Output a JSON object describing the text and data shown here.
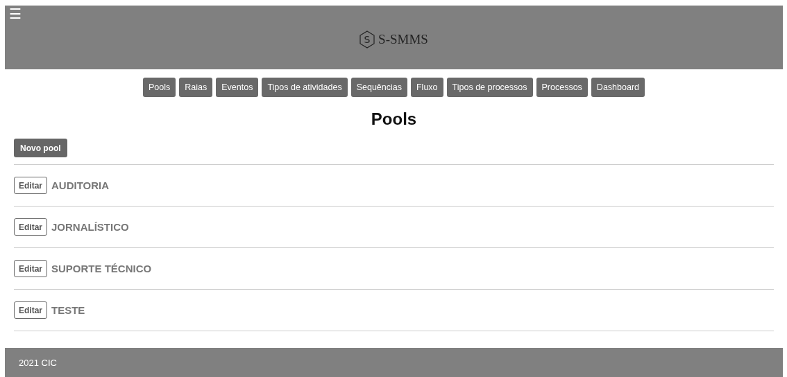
{
  "header": {
    "menu_glyph": "☰",
    "brand": "S-SMMS",
    "logo_letter": "S"
  },
  "nav": [
    "Pools",
    "Raias",
    "Eventos",
    "Tipos de atividades",
    "Sequências",
    "Fluxo",
    "Tipos de processos",
    "Processos",
    "Dashboard"
  ],
  "page_title": "Pools",
  "new_button": "Novo pool",
  "pools": [
    {
      "edit_label": "Editar",
      "name": "AUDITORIA"
    },
    {
      "edit_label": "Editar",
      "name": "JORNALÍSTICO"
    },
    {
      "edit_label": "Editar",
      "name": "SUPORTE TÉCNICO"
    },
    {
      "edit_label": "Editar",
      "name": "TESTE"
    }
  ],
  "footer": "2021 CIC"
}
